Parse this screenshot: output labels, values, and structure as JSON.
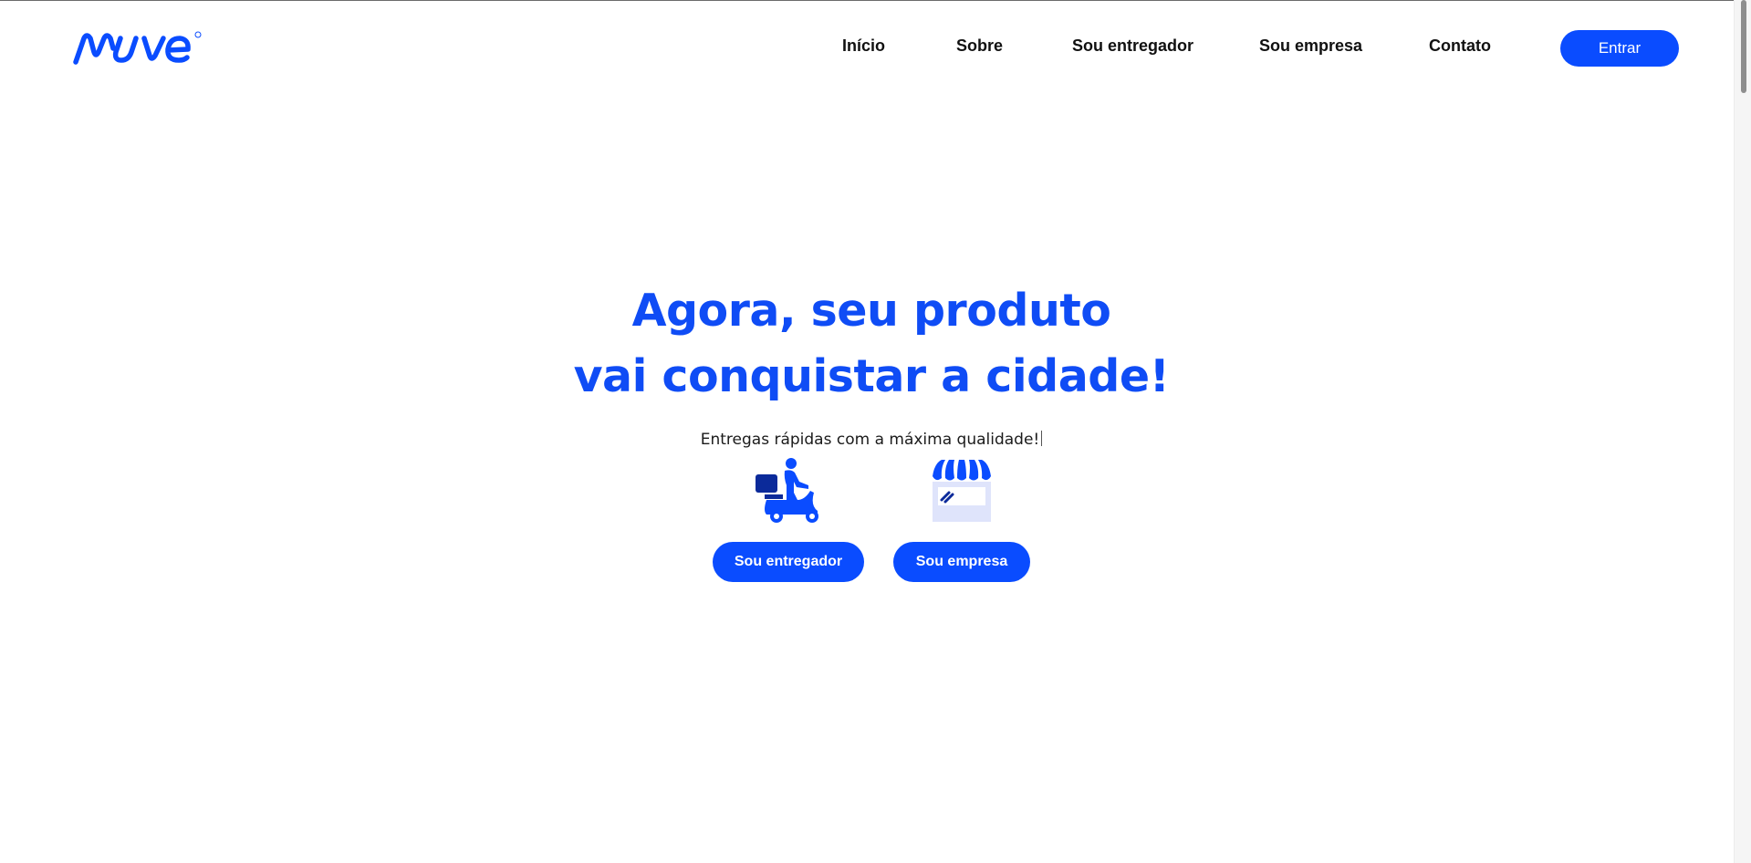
{
  "brand": {
    "logo_text": "muve",
    "color": "#0a4cff"
  },
  "nav": {
    "items": [
      {
        "label": "Início"
      },
      {
        "label": "Sobre"
      },
      {
        "label": "Sou entregador"
      },
      {
        "label": "Sou empresa"
      },
      {
        "label": "Contato"
      }
    ],
    "login_label": "Entrar"
  },
  "hero": {
    "title_line1": "Agora, seu produto",
    "title_line2": "vai conquistar a cidade!",
    "subtitle": "Entregas rápidas com a máxima qualidade!",
    "icons": [
      "delivery-scooter-icon",
      "storefront-icon"
    ],
    "btn_courier": "Sou entregador",
    "btn_company": "Sou empresa"
  }
}
